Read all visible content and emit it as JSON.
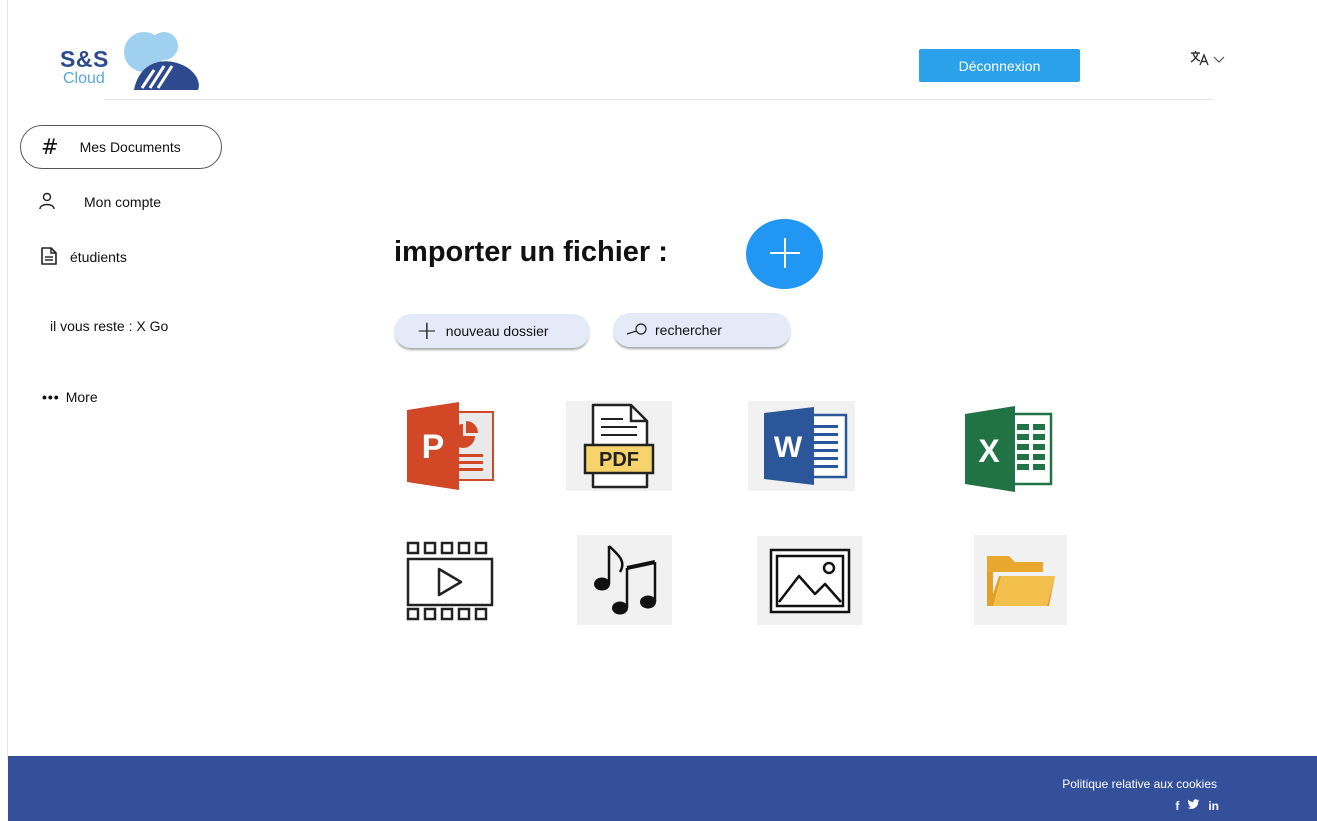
{
  "brand": {
    "name": "S&S",
    "sub": "Cloud"
  },
  "header": {
    "logout_label": "Déconnexion",
    "language_icon": "translate-icon"
  },
  "sidebar": {
    "items": [
      {
        "label": "Mes Documents",
        "icon": "hash-icon",
        "active": true
      },
      {
        "label": "Mon compte",
        "icon": "user-icon"
      },
      {
        "label": "étudients",
        "icon": "document-icon"
      }
    ],
    "storage": "il vous reste : X  Go",
    "more_label": "More"
  },
  "main": {
    "import_title": "importer un  fichier :",
    "new_folder_label": "nouveau dossier",
    "search_label": "rechercher",
    "file_types": [
      {
        "icon": "powerpoint-icon",
        "label": "P"
      },
      {
        "icon": "pdf-icon",
        "label": "PDF"
      },
      {
        "icon": "word-icon",
        "label": "W"
      },
      {
        "icon": "excel-icon",
        "label": "X"
      },
      {
        "icon": "video-icon"
      },
      {
        "icon": "music-icon"
      },
      {
        "icon": "image-icon"
      },
      {
        "icon": "folder-icon"
      }
    ]
  },
  "footer": {
    "cookies_label": "Politique relative aux cookies",
    "social": [
      "f",
      "in"
    ]
  },
  "colors": {
    "primary": "#2aa1ea",
    "footer": "#35509a",
    "pill": "#e4eaf8",
    "logo_dark": "#2e4a8f",
    "logo_light": "#5aa6dc"
  }
}
